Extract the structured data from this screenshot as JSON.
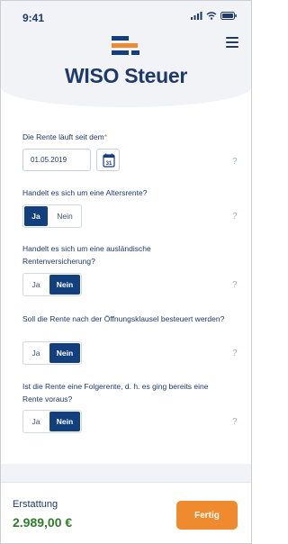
{
  "status_bar": {
    "time": "9:41"
  },
  "brand": {
    "name": "WISO Steuer"
  },
  "form": {
    "start_date": {
      "label": "Die Rente läuft seit dem",
      "required_mark": "*",
      "value": "01.05.2019"
    },
    "questions": [
      {
        "label": "Handelt es sich um eine Altersrente?",
        "yes": "Ja",
        "no": "Nein",
        "selected": "Ja"
      },
      {
        "label": "Handelt es sich um eine ausländische Rentenversicherung?",
        "yes": "Ja",
        "no": "Nein",
        "selected": "Nein"
      },
      {
        "label": "Soll die Rente nach der Öffnungsklausel besteuert werden?",
        "yes": "Ja",
        "no": "Nein",
        "selected": "Nein"
      },
      {
        "label": "Ist die Rente eine Folgerente, d. h. es ging bereits eine Rente voraus?",
        "yes": "Ja",
        "no": "Nein",
        "selected": "Nein"
      }
    ],
    "help_glyph": "?"
  },
  "footer": {
    "refund_label": "Erstattung",
    "refund_value": "2.989,00 €",
    "done_label": "Fertig"
  },
  "colors": {
    "brand_blue": "#123f7e",
    "accent_orange": "#f08a2e",
    "refund_green": "#2f7d2b"
  }
}
